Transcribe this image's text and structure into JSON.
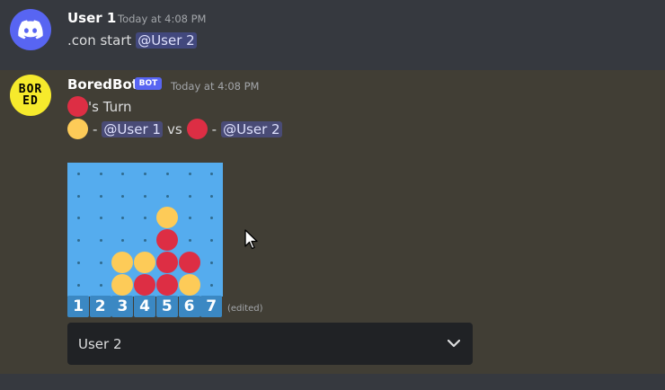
{
  "message1": {
    "username": "User 1",
    "timestamp": "Today at 4:08 PM",
    "text": ".con start",
    "mention": "@User 2",
    "avatar_icon": "discord-logo-icon"
  },
  "message2": {
    "username": "BoredBot",
    "bot_badge": "BOT",
    "timestamp": "Today at 4:08 PM",
    "avatar_text_top": "BOR",
    "avatar_text_bottom": "ED",
    "turn_text": "'s Turn",
    "turn_piece": "red",
    "players": {
      "p1_piece": "yellow",
      "p1_sep": "-",
      "p1_mention": "@User 1",
      "vs": "vs",
      "p2_piece": "red",
      "p2_sep": "-",
      "p2_mention": "@User 2"
    },
    "board": {
      "rows": [
        [
          "empty",
          "empty",
          "empty",
          "empty",
          "empty",
          "empty",
          "empty"
        ],
        [
          "empty",
          "empty",
          "empty",
          "empty",
          "empty",
          "empty",
          "empty"
        ],
        [
          "empty",
          "empty",
          "empty",
          "empty",
          "yellow",
          "empty",
          "empty"
        ],
        [
          "empty",
          "empty",
          "empty",
          "empty",
          "red",
          "empty",
          "empty"
        ],
        [
          "empty",
          "empty",
          "yellow",
          "yellow",
          "red",
          "red",
          "empty"
        ],
        [
          "empty",
          "empty",
          "yellow",
          "red",
          "red",
          "yellow",
          "empty"
        ]
      ],
      "column_numbers": [
        "1",
        "2",
        "3",
        "4",
        "5",
        "6",
        "7"
      ]
    },
    "edited": "(edited)",
    "select": {
      "value": "User 2",
      "icon": "chevron-down-icon"
    }
  },
  "colors": {
    "background": "#36393f",
    "highlight_background": "#413e35",
    "board_blue": "#55acee",
    "number_blue": "#3b88c3",
    "red_piece": "#dd2e44",
    "yellow_piece": "#fdcb58",
    "blurple": "#5865f2",
    "select_bg": "#202225"
  }
}
